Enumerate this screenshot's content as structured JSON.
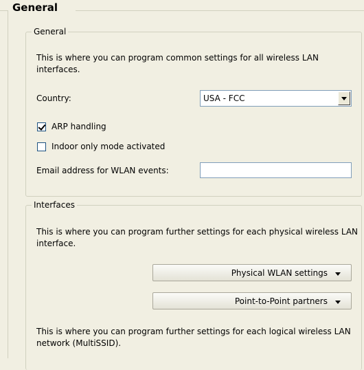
{
  "page": {
    "title": "General"
  },
  "general_group": {
    "title": "General",
    "description": "This is where you can program common settings for all wireless LAN interfaces.",
    "country_label": "Country:",
    "country_value": "USA - FCC",
    "arp_label": "ARP handling",
    "arp_checked": true,
    "indoor_label": "Indoor only mode activated",
    "indoor_checked": false,
    "email_label": "Email address for WLAN events:",
    "email_value": ""
  },
  "interfaces_group": {
    "title": "Interfaces",
    "description_physical": "This is where you can program further settings for each physical wireless LAN interface.",
    "physical_button": "Physical WLAN settings",
    "p2p_button": "Point-to-Point partners",
    "description_logical": "This is where you can program further settings for each logical wireless LAN network (MultiSSID)."
  },
  "icons": {
    "dropdown": "chevron-down-icon",
    "check": "checkmark-icon"
  },
  "colors": {
    "background": "#f1efe2",
    "group_border": "#d0d0bf",
    "input_border": "#7f9db9"
  }
}
